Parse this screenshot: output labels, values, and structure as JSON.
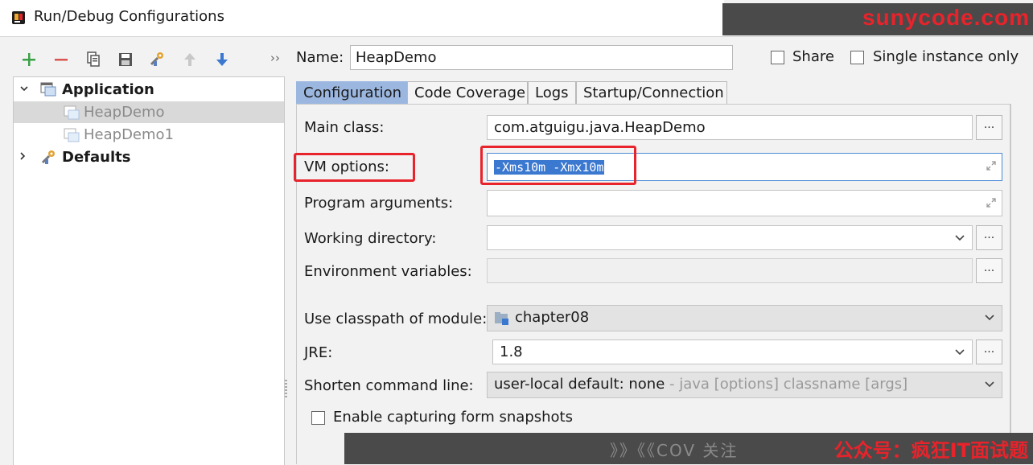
{
  "window": {
    "title": "Run/Debug Configurations",
    "watermark": "sunycode.com"
  },
  "toolbar": {
    "icons": [
      "add-icon",
      "remove-icon",
      "copy-icon",
      "save-icon",
      "wrench-icon",
      "move-up-icon",
      "move-down-icon"
    ],
    "more": "››"
  },
  "tree": {
    "application": "Application",
    "items": [
      "HeapDemo",
      "HeapDemo1"
    ],
    "defaults": "Defaults"
  },
  "form": {
    "name_label": "Name:",
    "name_value": "HeapDemo",
    "share_label": "Share",
    "single_instance_label": "Single instance only"
  },
  "tabs": [
    "Configuration",
    "Code Coverage",
    "Logs",
    "Startup/Connection"
  ],
  "config": {
    "main_class_label": "Main class:",
    "main_class_value": "com.atguigu.java.HeapDemo",
    "vm_options_label": "VM options:",
    "vm_options_value": "-Xms10m -Xmx10m",
    "program_args_label": "Program arguments:",
    "working_dir_label": "Working directory:",
    "env_vars_label": "Environment variables:",
    "classpath_label": "Use classpath of module:",
    "classpath_value": "chapter08",
    "jre_label": "JRE:",
    "jre_value": "1.8",
    "shorten_label": "Shorten command line:",
    "shorten_value": "user-local default: none",
    "shorten_hint": " - java [options] classname [args]",
    "capture_label": "Enable capturing form snapshots",
    "browse": "..."
  },
  "footer": {
    "watermark": "公众号：疯狂IT面试题",
    "faded": "》》《《COV 关注"
  },
  "colors": {
    "accent_tab": "#9bb7e0",
    "selection": "#3b78d0",
    "highlight_box": "#e8232b"
  }
}
